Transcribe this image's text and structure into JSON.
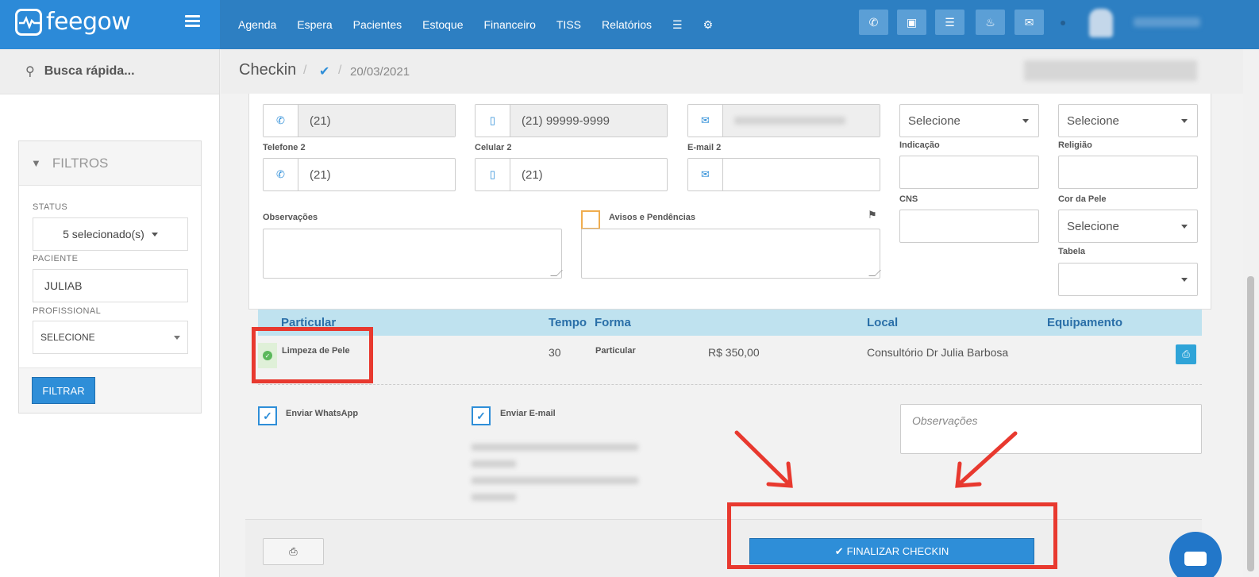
{
  "app": {
    "logo_text": "feegow",
    "nav": [
      "Agenda",
      "Espera",
      "Pacientes",
      "Estoque",
      "Financeiro",
      "TISS",
      "Relatórios"
    ],
    "nav_icons": [
      "database-icon",
      "gear-icon"
    ],
    "toolbar_icons": [
      "phone-icon",
      "inbox-icon",
      "list-icon",
      "bell-icon",
      "chat-icon"
    ]
  },
  "sidebar": {
    "search_placeholder": "Busca rápida...",
    "filters_title": "FILTROS",
    "status_label": "STATUS",
    "status_value": "5 selecionado(s)",
    "patient_label": "PACIENTE",
    "patient_value": "JULIAB",
    "professional_label": "PROFISSIONAL",
    "professional_value": "SELECIONE",
    "filter_button": "FILTRAR"
  },
  "breadcrumb": {
    "title": "Checkin",
    "date": "20/03/2021"
  },
  "form": {
    "phone_value": "(21)",
    "cell_value": "(21) 99999-9999",
    "phone2_label": "Telefone 2",
    "phone2_value": "(21)",
    "cell2_label": "Celular 2",
    "cell2_value": "(21)",
    "email2_label": "E-mail 2",
    "civil_status_value": "Selecione",
    "origin_value": "Selecione",
    "indication_label": "Indicação",
    "religion_label": "Religião",
    "cns_label": "CNS",
    "skin_color_label": "Cor da Pele",
    "skin_color_value": "Selecione",
    "table_label": "Tabela",
    "observations_label": "Observações",
    "warnings_label": "Avisos e Pendências"
  },
  "procedures": {
    "headers": {
      "particular": "Particular",
      "tempo": "Tempo",
      "forma": "Forma",
      "local": "Local",
      "equipamento": "Equipamento"
    },
    "row": {
      "name": "Limpeza de Pele",
      "time": "30",
      "form": "Particular",
      "value": "R$ 350,00",
      "location": "Consultório Dr Julia Barbosa"
    }
  },
  "notify": {
    "whatsapp_label": "Enviar WhatsApp",
    "email_label": "Enviar E-mail",
    "observations_placeholder": "Observações"
  },
  "footer": {
    "finalize_button": "FINALIZAR CHECKIN"
  },
  "colors": {
    "topbar": "#2d7fc2",
    "primary": "#2e8ed8",
    "highlight": "#e8392f",
    "success": "#5cb85c"
  }
}
